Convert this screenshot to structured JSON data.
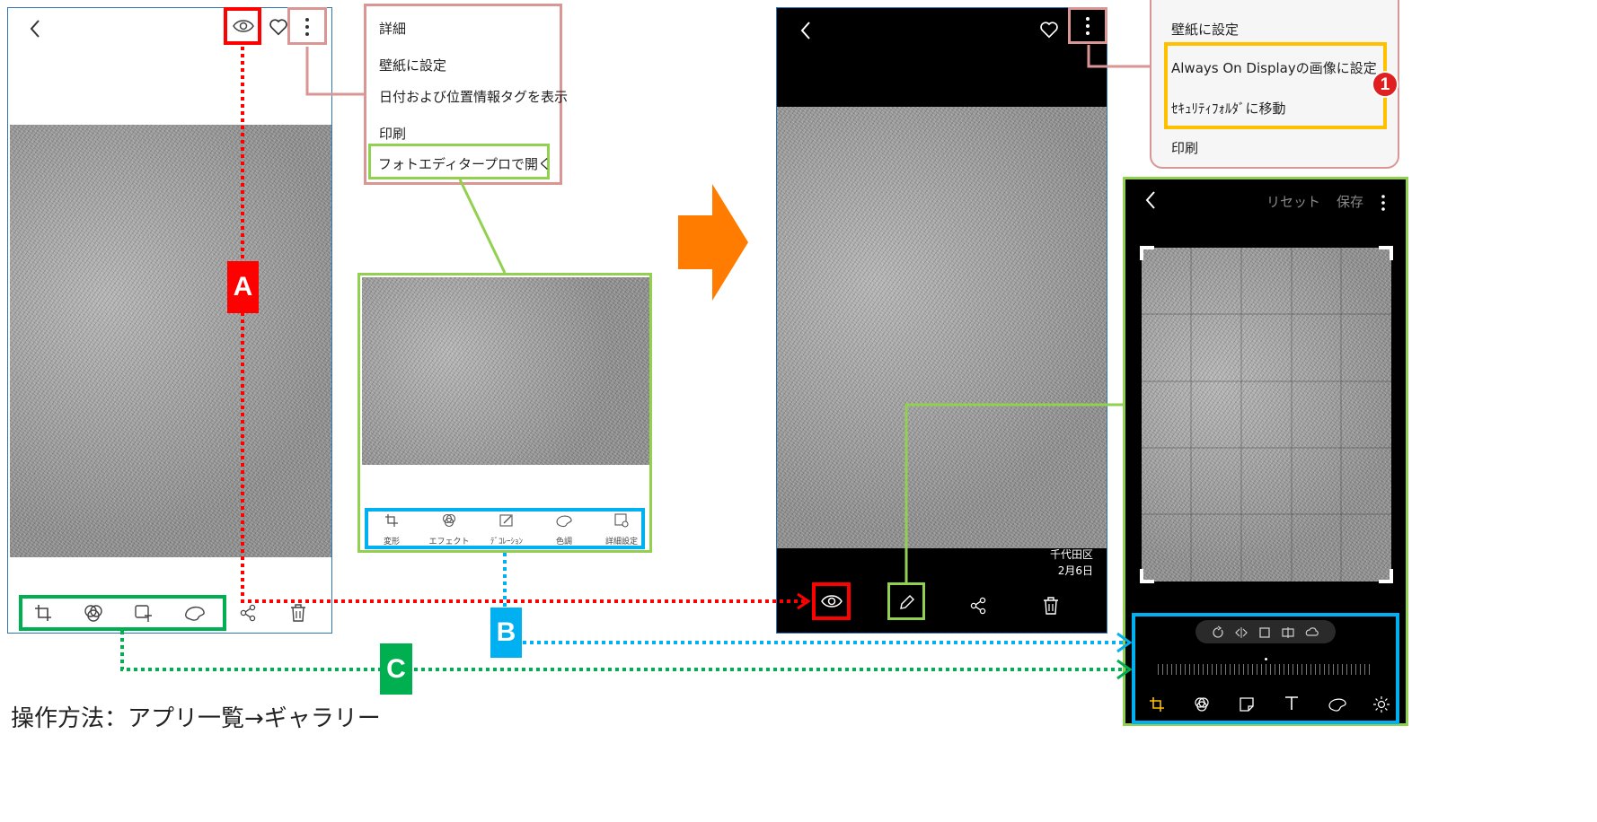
{
  "phone_a": {
    "bottom_tools": [
      "crop-tool",
      "effect-tool",
      "decoration-tool",
      "color-tool"
    ]
  },
  "overflow_menu_a": {
    "items": [
      "詳細",
      "壁紙に設定",
      "日付および位置情報タグを表示",
      "印刷",
      "フォトエディタープロで開く"
    ]
  },
  "editor_preview": {
    "tools": [
      {
        "icon": "transform-icon",
        "label": "変形"
      },
      {
        "icon": "effect-icon",
        "label": "エフェクト"
      },
      {
        "icon": "decoration-icon",
        "label": "ﾃﾞｺﾚｰｼｮﾝ"
      },
      {
        "icon": "color-icon",
        "label": "色調"
      },
      {
        "icon": "advanced-settings-icon",
        "label": "詳細設定"
      }
    ]
  },
  "phone_b": {
    "location": "千代田区",
    "date": "2月6日"
  },
  "overflow_menu_b": {
    "items": [
      "壁紙に設定",
      "Always On Displayの画像に設定",
      "ｾｷｭﾘﾃｨﾌｫﾙﾀﾞに移動",
      "印刷"
    ],
    "badge": "1"
  },
  "editor": {
    "reset_label": "リセット",
    "save_label": "保存"
  },
  "markers": {
    "a": "A",
    "b": "B",
    "c": "C"
  },
  "caption": "操作方法：アプリ一覧→ギャラリー",
  "colors": {
    "red": "#ff0000",
    "green": "#00b050",
    "blue": "#00b0f0",
    "pink": "#d99694",
    "lime": "#92d050",
    "orange": "#ff7c00",
    "yellow": "#ffc000"
  }
}
